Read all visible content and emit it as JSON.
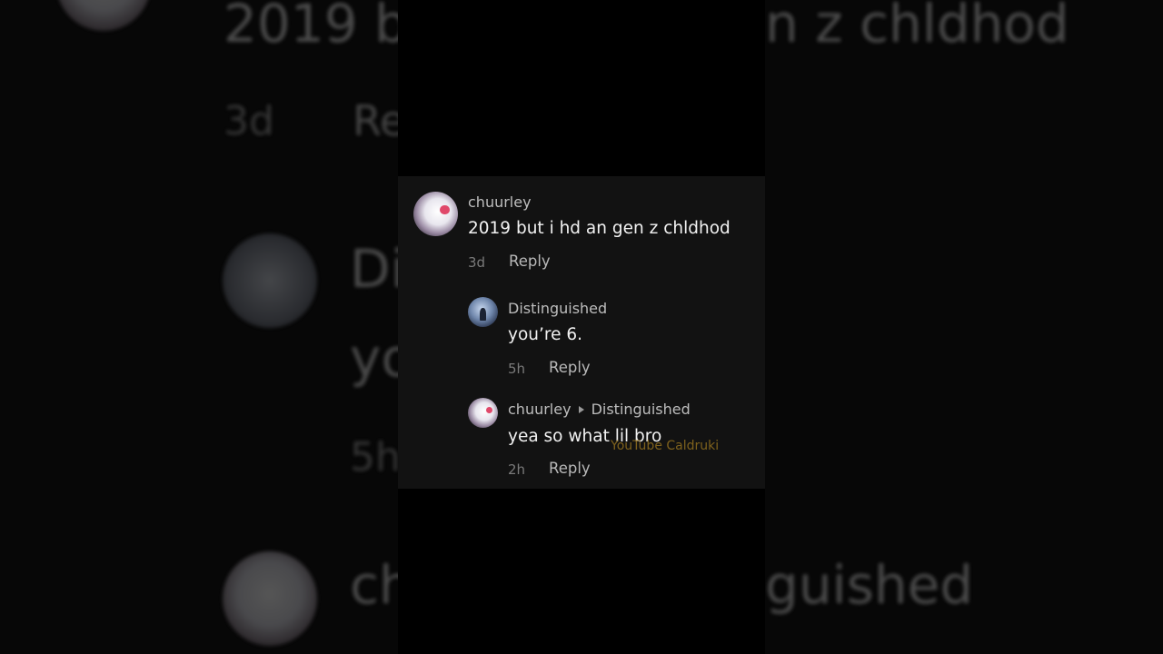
{
  "background": {
    "top_text": "2019 b",
    "top_text_right": "n z chldhod",
    "meta_time": "3d",
    "meta_reply": "Re",
    "mid_name": "Di",
    "mid_text": "yo",
    "mid_time": "5h",
    "bottom_name": "ch",
    "bottom_name_right": "guished"
  },
  "comments": [
    {
      "username": "chuurley",
      "text": "2019 but i hd an gen z chldhod",
      "time": "3d",
      "reply_label": "Reply"
    },
    {
      "username": "Distinguished",
      "text": "you’re 6.",
      "time": "5h",
      "reply_label": "Reply"
    },
    {
      "username": "chuurley",
      "reply_to": "Distinguished",
      "text": "yea so what lil bro",
      "time": "2h",
      "reply_label": "Reply"
    }
  ],
  "watermark": "YouTube Caldruki",
  "colors": {
    "card_bg": "#121212",
    "page_bg": "#000000",
    "watermark": "#8a6a1e"
  }
}
